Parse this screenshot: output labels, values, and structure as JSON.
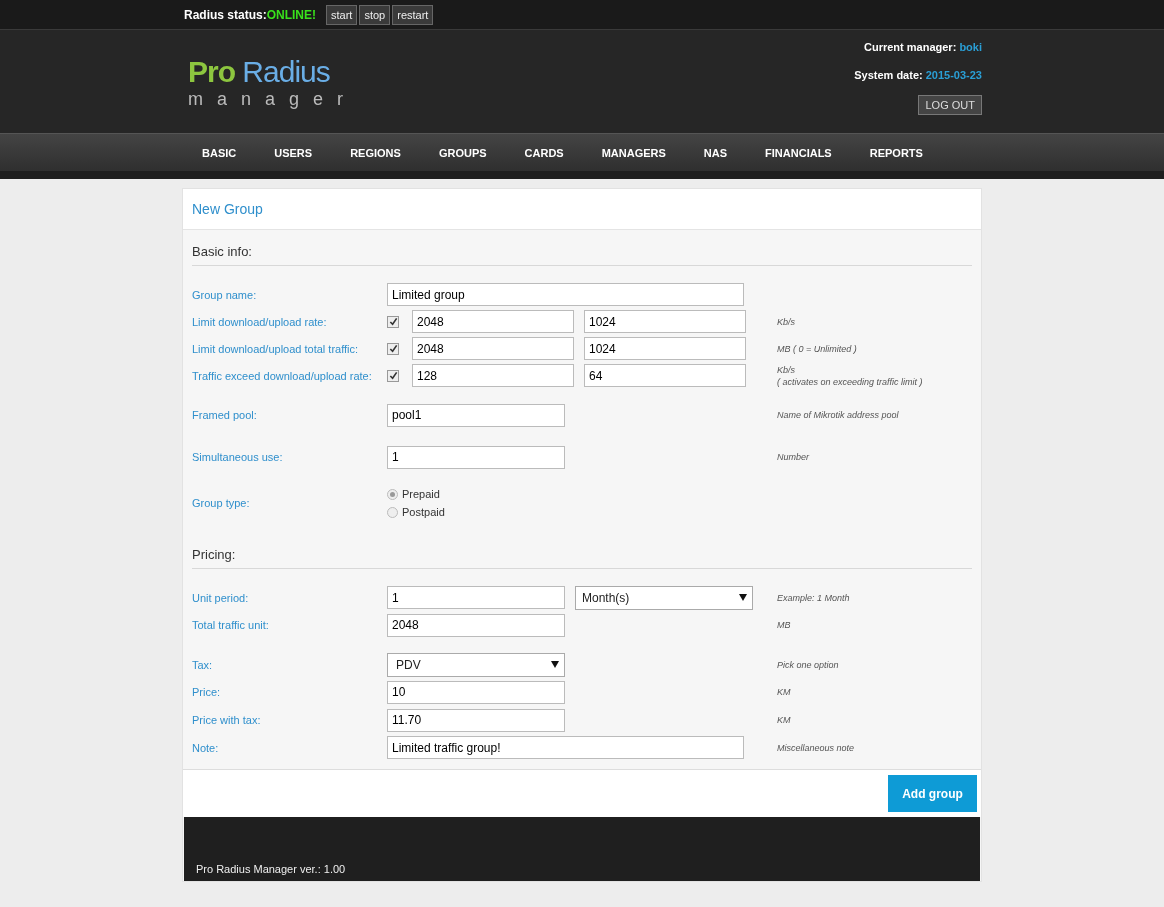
{
  "status_bar": {
    "label": "Radius status:",
    "status": "ONLINE!",
    "buttons": [
      "start",
      "stop",
      "restart"
    ]
  },
  "logo": {
    "pro": "Pro",
    "radius": "Radius",
    "tagline": "manager"
  },
  "manager": {
    "label": "Current manager:",
    "value": "boki"
  },
  "system_date": {
    "label": "System date:",
    "value": "2015-03-23"
  },
  "logout": "LOG OUT",
  "nav": [
    {
      "label": "BASIC"
    },
    {
      "label": "USERS"
    },
    {
      "label": "REGIONS"
    },
    {
      "label": "GROUPS"
    },
    {
      "label": "CARDS"
    },
    {
      "label": "MANAGERS"
    },
    {
      "label": "NAS"
    },
    {
      "label": "FINANCIALS"
    },
    {
      "label": "REPORTS"
    }
  ],
  "page_title": "New Group",
  "sections": [
    {
      "title": "Basic info:",
      "rows": [
        {
          "kind": "long",
          "label": "Group name:",
          "value": "Limited group"
        },
        {
          "kind": "pair",
          "label": "Limit download/upload rate:",
          "checked": true,
          "values": [
            "2048",
            "1024"
          ],
          "hint": [
            "Kb/s"
          ]
        },
        {
          "kind": "pair",
          "label": "Limit download/upload total traffic:",
          "checked": true,
          "values": [
            "2048",
            "1024"
          ],
          "hint": [
            "MB ( 0 = Unlimited )"
          ]
        },
        {
          "kind": "pair",
          "label": "Traffic exceed download/upload rate:",
          "checked": true,
          "values": [
            "128",
            "64"
          ],
          "hint": [
            "Kb/s",
            "( activates on exceeding traffic limit )"
          ]
        },
        {
          "kind": "short",
          "label": "Framed pool:",
          "value": "pool1",
          "hint": [
            "Name of Mikrotik address pool"
          ]
        },
        {
          "kind": "short",
          "label": "Simultaneous use:",
          "value": "1",
          "hint": [
            "Number"
          ]
        },
        {
          "kind": "radio",
          "label": "Group type:",
          "options": [
            {
              "label": "Prepaid",
              "selected": true
            },
            {
              "label": "Postpaid",
              "selected": false
            }
          ]
        }
      ]
    },
    {
      "title": "Pricing:",
      "rows": [
        {
          "kind": "period",
          "label": "Unit period:",
          "value": "1",
          "option": "Month(s)",
          "hint": [
            "Example: 1 Month"
          ]
        },
        {
          "kind": "short",
          "label": "Total traffic unit:",
          "value": "2048",
          "hint": [
            "MB"
          ]
        },
        {
          "kind": "select",
          "label": "Tax:",
          "option": "PDV",
          "hint": [
            "Pick one option"
          ]
        },
        {
          "kind": "short",
          "label": "Price:",
          "value": "10",
          "hint": [
            "KM"
          ]
        },
        {
          "kind": "short",
          "label": "Price with tax:",
          "value": "11.70",
          "hint": [
            "KM"
          ]
        },
        {
          "kind": "long",
          "label": "Note:",
          "value": "Limited traffic group!",
          "hint": [
            "Miscellaneous note"
          ]
        }
      ]
    }
  ],
  "submit": "Add group",
  "footer": "Pro Radius Manager  ver.: 1.00"
}
